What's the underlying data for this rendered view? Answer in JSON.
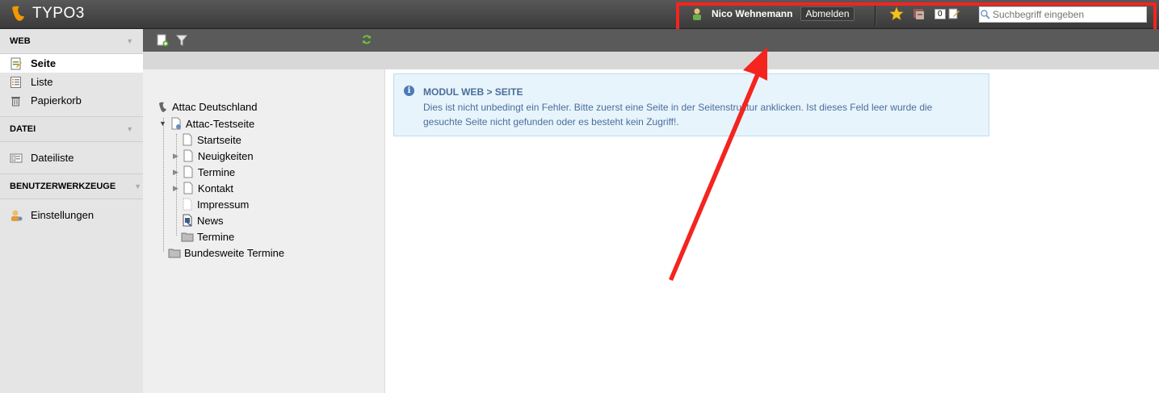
{
  "topbar": {
    "logo_text": "TYPO3",
    "user_name": "Nico Wehnemann",
    "logout_label": "Abmelden",
    "open_docs_count": "0",
    "search_placeholder": "Suchbegriff eingeben"
  },
  "modmenu": {
    "groups": [
      {
        "title": "WEB",
        "items": [
          "Seite",
          "Liste",
          "Papierkorb"
        ]
      },
      {
        "title": "DATEI",
        "items": [
          "Dateiliste"
        ]
      },
      {
        "title": "BENUTZERWERKZEUGE",
        "items": [
          "Einstellungen"
        ]
      }
    ],
    "active_item": "Seite"
  },
  "pagetree": {
    "root": "Attac Deutschland",
    "site": "Attac-Testseite",
    "children": [
      "Startseite",
      "Neuigkeiten",
      "Termine",
      "Kontakt",
      "Impressum",
      "News",
      "Termine"
    ],
    "sibling": "Bundesweite Termine"
  },
  "info": {
    "title": "MODUL WEB > SEITE",
    "message": "Dies ist nicht unbedingt ein Fehler. Bitte zuerst eine Seite in der Seitenstruktur anklicken. Ist dieses Feld leer wurde die gesuchte Seite nicht gefunden oder es besteht kein Zugriff!."
  },
  "colors": {
    "annotation_red": "#f4241f",
    "info_bg": "#e8f4fc",
    "info_text": "#4a6e9a"
  }
}
